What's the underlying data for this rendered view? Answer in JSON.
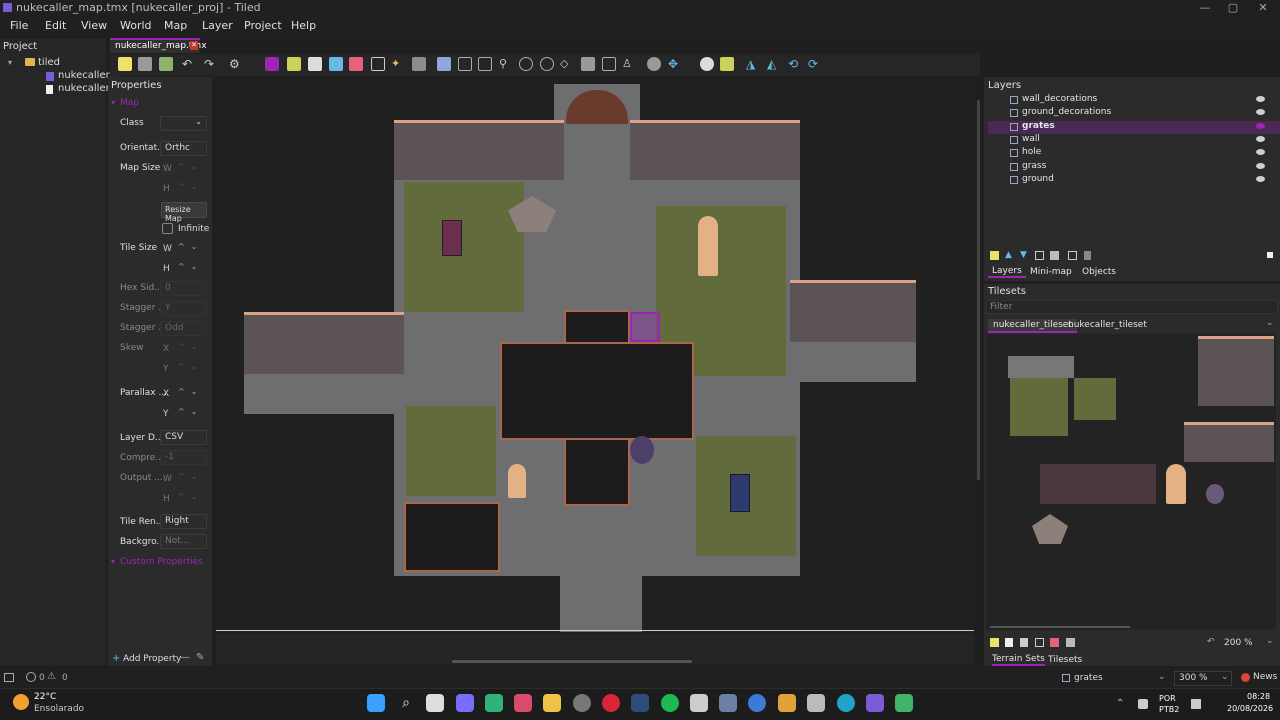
{
  "window": {
    "title": "nukecaller_map.tmx [nukecaller_proj] - Tiled",
    "controls": [
      "—",
      "▢",
      "✕"
    ]
  },
  "menu": [
    "File",
    "Edit",
    "View",
    "World",
    "Map",
    "Layer",
    "Project",
    "Help"
  ],
  "project_panel": {
    "title": "Project",
    "root": "tiled",
    "files": [
      "nukecaller...",
      "nukecaller..."
    ]
  },
  "doc_tab": {
    "label": "nukecaller_map.tmx",
    "close": "✕"
  },
  "properties": {
    "title": "Properties",
    "section_map": "Map",
    "rows": {
      "class": "Class",
      "orientation": "Orientat...",
      "orientation_value": "Orthc",
      "map_size": "Map Size",
      "w": "W",
      "h": "H",
      "resize_map": "Resize Map",
      "infinite": "Infinite",
      "tile_size": "Tile Size",
      "hex_side": "Hex Sid...",
      "hex_side_value": "0",
      "stagger1": "Stagger ...",
      "stagger1_value": "Y",
      "stagger2": "Stagger ...",
      "stagger2_value": "Odd",
      "skew": "Skew",
      "x": "X",
      "y": "Y",
      "parallax": "Parallax ...",
      "layer_data": "Layer D...",
      "layer_data_value": "CSV",
      "compression": "Compre...",
      "compression_value": "-1",
      "output": "Output ...",
      "tile_render": "Tile Ren...",
      "tile_render_value": "Right",
      "background": "Backgro...",
      "background_value": "Not..."
    },
    "custom_properties": "Custom Properties",
    "add_property": "Add Property"
  },
  "layers_panel": {
    "title": "Layers",
    "layers": [
      {
        "name": "wall_decorations",
        "selected": false
      },
      {
        "name": "ground_decorations",
        "selected": false
      },
      {
        "name": "grates",
        "selected": true
      },
      {
        "name": "wall",
        "selected": false
      },
      {
        "name": "hole",
        "selected": false
      },
      {
        "name": "grass",
        "selected": false
      },
      {
        "name": "ground",
        "selected": false
      }
    ],
    "tabs": [
      "Layers",
      "Mini-map",
      "Objects"
    ]
  },
  "tilesets_panel": {
    "title": "Tilesets",
    "filter_placeholder": "Filter",
    "tabs": [
      "nukecaller_tileset",
      "nukecaller_tileset"
    ],
    "zoom": "200 %",
    "bottom_tabs": [
      "Terrain Sets",
      "Tilesets"
    ]
  },
  "statusbar": {
    "errors": "0",
    "warnings": "0",
    "current_layer": "grates",
    "zoom": "300 %",
    "news": "News"
  },
  "taskbar": {
    "weather_temp": "22°C",
    "weather_desc": "Ensolarado",
    "lang": "POR",
    "layout": "PTB2",
    "time": "08:28",
    "date": "20/08/2026"
  },
  "colors": {
    "accent": "#9b26b6",
    "selected_layer_bg": "#4a2a55",
    "grass": "#616b3c",
    "brick_top": "#d9a384"
  }
}
